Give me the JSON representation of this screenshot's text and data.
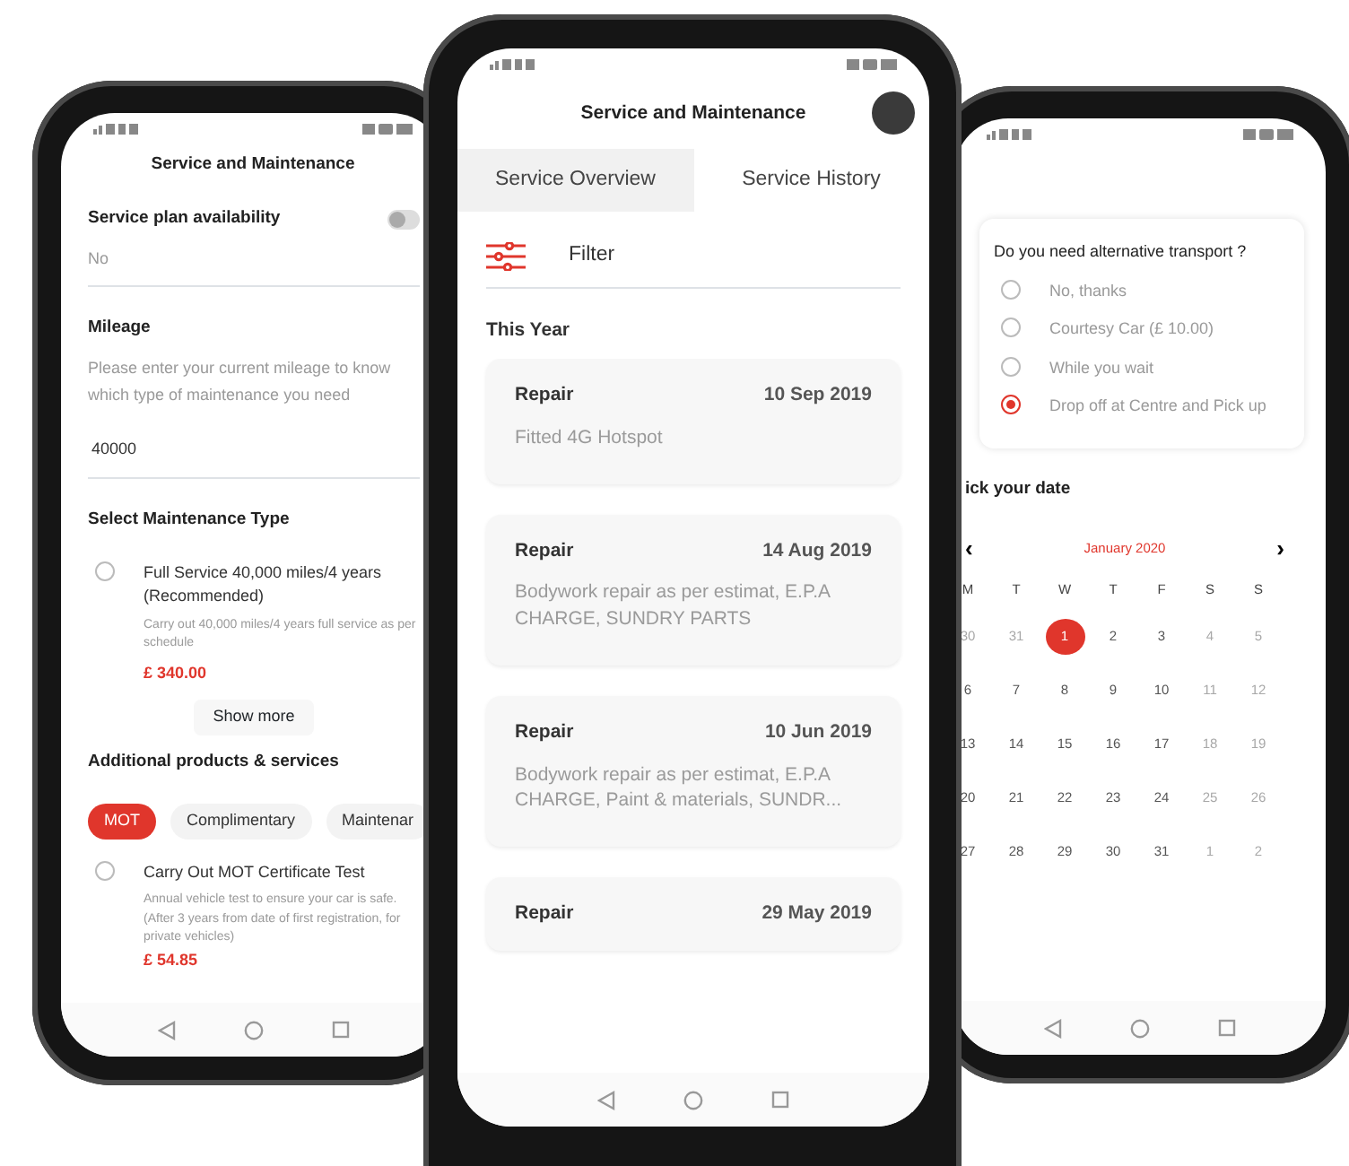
{
  "left_phone": {
    "title": "Service and Maintenance",
    "service_plan": {
      "label": "Service plan availability",
      "value": "No",
      "on": false
    },
    "mileage": {
      "label": "Mileage",
      "help": "Please enter your current mileage to know which type of maintenance you need",
      "value": "40000"
    },
    "maintenance": {
      "heading": "Select Maintenance Type",
      "options": [
        {
          "title": "Full Service 40,000 miles/4 years (Recommended)",
          "description": "Carry out 40,000 miles/4 years full service as per schedule",
          "price": "£ 340.00",
          "selected": false
        }
      ]
    },
    "show_more": "Show more",
    "additional": {
      "heading": "Additional products & services",
      "chips": [
        {
          "label": "MOT",
          "selected": true
        },
        {
          "label": "Complimentary",
          "selected": false
        },
        {
          "label": "Maintenar",
          "selected": false
        }
      ],
      "products": [
        {
          "title": "Carry Out MOT Certificate Test",
          "description": "Annual vehicle test to ensure your car is safe. (After 3 years from date of first registration, for private vehicles)",
          "price": "£ 54.85",
          "selected": false
        }
      ]
    }
  },
  "center_phone": {
    "title": "Service and Maintenance",
    "tabs": [
      {
        "label": "Service Overview",
        "selected": false
      },
      {
        "label": "Service History",
        "selected": true
      }
    ],
    "filter": "Filter",
    "section": "This Year",
    "records": [
      {
        "type": "Repair",
        "date": "10 Sep 2019",
        "description": "Fitted 4G Hotspot"
      },
      {
        "type": "Repair",
        "date": "14 Aug 2019",
        "description": "Bodywork repair as per estimat, E.P.A CHARGE, SUNDRY PARTS"
      },
      {
        "type": "Repair",
        "date": "10 Jun 2019",
        "description": "Bodywork repair as per estimat, E.P.A CHARGE, Paint & materials, SUNDR..."
      },
      {
        "type": "Repair",
        "date": "29 May 2019"
      }
    ]
  },
  "right_phone": {
    "transport": {
      "question": "Do you need alternative transport ?",
      "options": [
        {
          "label": "No, thanks",
          "selected": false
        },
        {
          "label": "Courtesy Car (£ 10.00)",
          "selected": false
        },
        {
          "label": "While you wait",
          "selected": false
        },
        {
          "label": "Drop off at Centre and Pick up",
          "selected": true
        }
      ]
    },
    "date_heading": "ick your date",
    "calendar": {
      "prev": "‹",
      "month": "January 2020",
      "next": "›",
      "weekdays": [
        "M",
        "T",
        "W",
        "T",
        "F",
        "S",
        "S"
      ],
      "days": [
        {
          "day": "30",
          "muted": true,
          "selected": false
        },
        {
          "day": "31",
          "muted": true,
          "selected": false
        },
        {
          "day": "1",
          "muted": false,
          "selected": true
        },
        {
          "day": "2",
          "muted": false,
          "selected": false
        },
        {
          "day": "3",
          "muted": false,
          "selected": false
        },
        {
          "day": "4",
          "muted": true,
          "selected": false
        },
        {
          "day": "5",
          "muted": true,
          "selected": false
        },
        {
          "day": "6",
          "muted": false,
          "selected": false
        },
        {
          "day": "7",
          "muted": false,
          "selected": false
        },
        {
          "day": "8",
          "muted": false,
          "selected": false
        },
        {
          "day": "9",
          "muted": false,
          "selected": false
        },
        {
          "day": "10",
          "muted": false,
          "selected": false
        },
        {
          "day": "11",
          "muted": true,
          "selected": false
        },
        {
          "day": "12",
          "muted": true,
          "selected": false
        },
        {
          "day": "13",
          "muted": false,
          "selected": false
        },
        {
          "day": "14",
          "muted": false,
          "selected": false
        },
        {
          "day": "15",
          "muted": false,
          "selected": false
        },
        {
          "day": "16",
          "muted": false,
          "selected": false
        },
        {
          "day": "17",
          "muted": false,
          "selected": false
        },
        {
          "day": "18",
          "muted": true,
          "selected": false
        },
        {
          "day": "19",
          "muted": true,
          "selected": false
        },
        {
          "day": "20",
          "muted": false,
          "selected": false
        },
        {
          "day": "21",
          "muted": false,
          "selected": false
        },
        {
          "day": "22",
          "muted": false,
          "selected": false
        },
        {
          "day": "23",
          "muted": false,
          "selected": false
        },
        {
          "day": "24",
          "muted": false,
          "selected": false
        },
        {
          "day": "25",
          "muted": true,
          "selected": false
        },
        {
          "day": "26",
          "muted": true,
          "selected": false
        },
        {
          "day": "27",
          "muted": false,
          "selected": false
        },
        {
          "day": "28",
          "muted": false,
          "selected": false
        },
        {
          "day": "29",
          "muted": false,
          "selected": false
        },
        {
          "day": "30",
          "muted": false,
          "selected": false
        },
        {
          "day": "31",
          "muted": false,
          "selected": false
        },
        {
          "day": "1",
          "muted": true,
          "selected": false
        },
        {
          "day": "2",
          "muted": true,
          "selected": false
        }
      ]
    }
  }
}
